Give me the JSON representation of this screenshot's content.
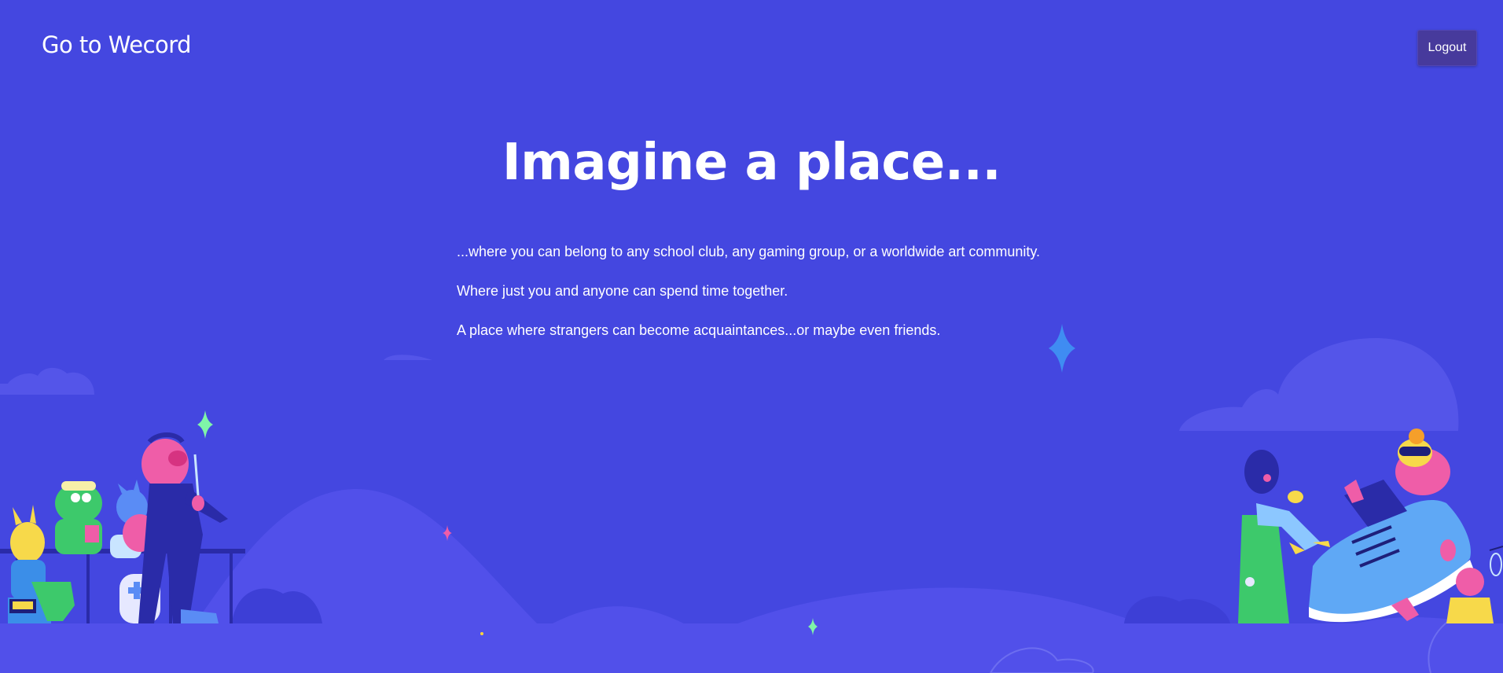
{
  "header": {
    "brand": "Go to Wecord",
    "logout_label": "Logout"
  },
  "hero": {
    "title": "Imagine a place...",
    "paragraphs": [
      "...where you can belong to any school club, any gaming group, or a worldwide art community.",
      "Where just you and anyone can spend time together.",
      "A place where strangers can become acquaintances...or maybe even friends."
    ]
  },
  "colors": {
    "background": "#4447e0",
    "hills": "#5150ea",
    "clouds": "#5455e9",
    "logout_button": "#473a9c",
    "sparkle_blue": "#3f8cf2",
    "sparkle_green": "#7ff5a8",
    "sparkle_pink": "#ef5da8"
  },
  "illustration": {
    "left_group": "left-characters-illustration",
    "right_group": "right-characters-illustration"
  }
}
